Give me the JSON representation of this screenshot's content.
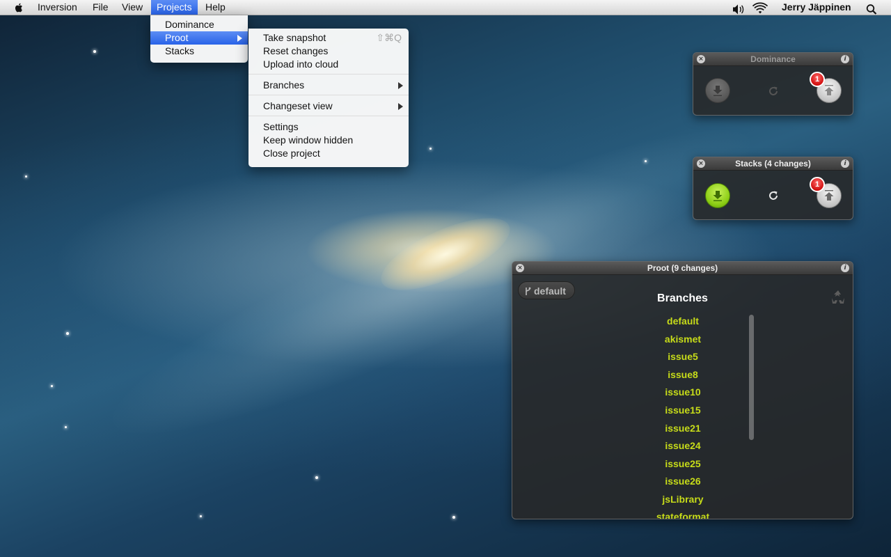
{
  "menubar": {
    "app_name": "Inversion",
    "items": [
      "File",
      "View",
      "Projects",
      "Help"
    ],
    "user": "Jerry Jäppinen"
  },
  "projects_menu": {
    "items": [
      "Dominance",
      "Proot",
      "Stacks"
    ],
    "selected": "Proot"
  },
  "proot_submenu": {
    "take_snapshot": "Take snapshot",
    "take_snapshot_shortcut": "⇧⌘Q",
    "reset_changes": "Reset changes",
    "upload_into_cloud": "Upload into cloud",
    "branches": "Branches",
    "changeset_view": "Changeset view",
    "settings": "Settings",
    "keep_window_hidden": "Keep window hidden",
    "close_project": "Close project"
  },
  "dominance_panel": {
    "title": "Dominance",
    "upload_badge": "1"
  },
  "stacks_panel": {
    "title": "Stacks (4 changes)",
    "upload_badge": "1"
  },
  "proot_panel": {
    "title": "Proot (9 changes)",
    "current_branch": "default",
    "branches_heading": "Branches",
    "branches": [
      "default",
      "akismet",
      "issue5",
      "issue8",
      "issue10",
      "issue15",
      "issue21",
      "issue24",
      "issue25",
      "issue26",
      "jsLibrary",
      "stateformat"
    ]
  },
  "colors": {
    "branch_text": "#c7dc19",
    "menu_highlight": "#2963e8",
    "badge": "#d10f0f",
    "pull_button": "#8bcc14"
  }
}
